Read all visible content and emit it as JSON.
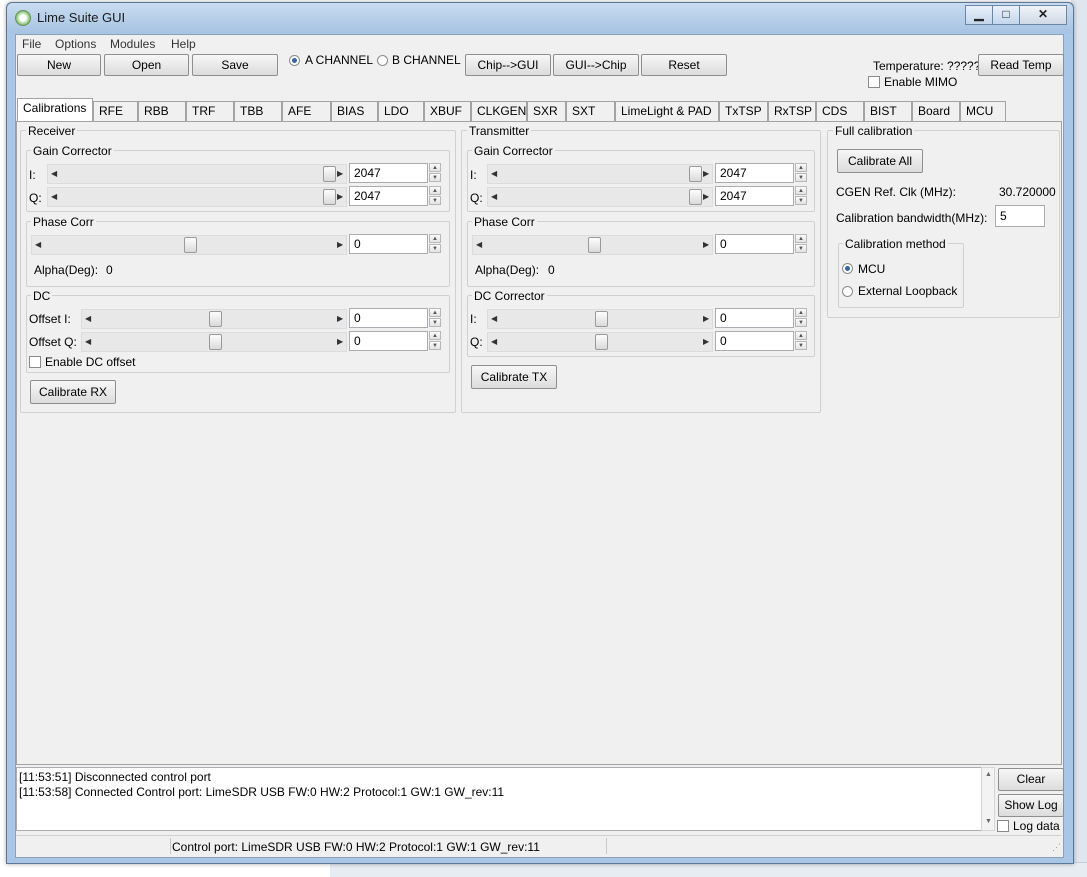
{
  "window": {
    "title": "Lime Suite GUI"
  },
  "menu": [
    "File",
    "Options",
    "Modules",
    "Help"
  ],
  "toolbar": {
    "new": "New",
    "open": "Open",
    "save": "Save",
    "channel_a": "A CHANNEL",
    "channel_b": "B CHANNEL",
    "chip_to_gui": "Chip-->GUI",
    "gui_to_chip": "GUI-->Chip",
    "reset": "Reset",
    "temperature": "Temperature: ?????",
    "read_temp": "Read Temp",
    "enable_mimo": "Enable MIMO"
  },
  "tabs": [
    "Calibrations",
    "RFE",
    "RBB",
    "TRF",
    "TBB",
    "AFE",
    "BIAS",
    "LDO",
    "XBUF",
    "CLKGEN",
    "SXR",
    "SXT",
    "LimeLight & PAD",
    "TxTSP",
    "RxTSP",
    "CDS",
    "BIST",
    "Board",
    "MCU"
  ],
  "receiver": {
    "title": "Receiver",
    "gain": {
      "title": "Gain Corrector",
      "i_label": "I:",
      "q_label": "Q:",
      "i_value": "2047",
      "q_value": "2047",
      "i_level": 1.0,
      "q_level": 1.0
    },
    "phase": {
      "title": "Phase Corr",
      "value": "0",
      "alpha_label": "Alpha(Deg):",
      "alpha_value": "0",
      "level": 0.5
    },
    "dc": {
      "title": "DC",
      "offset_i_label": "Offset I:",
      "offset_q_label": "Offset Q:",
      "offset_i_value": "0",
      "offset_q_value": "0",
      "level_i": 0.5,
      "level_q": 0.5,
      "enable_label": "Enable DC offset"
    },
    "calibrate": "Calibrate RX"
  },
  "transmitter": {
    "title": "Transmitter",
    "gain": {
      "title": "Gain Corrector",
      "i_label": "I:",
      "q_label": "Q:",
      "i_value": "2047",
      "q_value": "2047",
      "i_level": 1.0,
      "q_level": 1.0
    },
    "phase": {
      "title": "Phase Corr",
      "value": "0",
      "alpha_label": "Alpha(Deg):",
      "alpha_value": "0",
      "level": 0.5
    },
    "dc": {
      "title": "DC Corrector",
      "i_label": "I:",
      "q_label": "Q:",
      "i_value": "0",
      "q_value": "0",
      "level_i": 0.5,
      "level_q": 0.5
    },
    "calibrate": "Calibrate TX"
  },
  "full_calibration": {
    "title": "Full calibration",
    "calibrate_all": "Calibrate All",
    "cgen_label": "CGEN Ref. Clk (MHz):",
    "cgen_value": "30.720000",
    "bw_label": "Calibration bandwidth(MHz):",
    "bw_value": "5",
    "method_title": "Calibration method",
    "method_mcu": "MCU",
    "method_loopback": "External Loopback"
  },
  "log": {
    "lines": [
      "[11:53:51] Disconnected control port",
      "[11:53:58] Connected Control port: LimeSDR USB FW:0 HW:2 Protocol:1 GW:1 GW_rev:11"
    ],
    "clear": "Clear",
    "show_log": "Show Log",
    "log_data": "Log data"
  },
  "status": {
    "text": "Control port: LimeSDR USB FW:0 HW:2 Protocol:1 GW:1 GW_rev:11"
  },
  "colors": {
    "title_bar": "#a9c6e6",
    "panel": "#f0f0f0",
    "accent": "#3264a8"
  }
}
